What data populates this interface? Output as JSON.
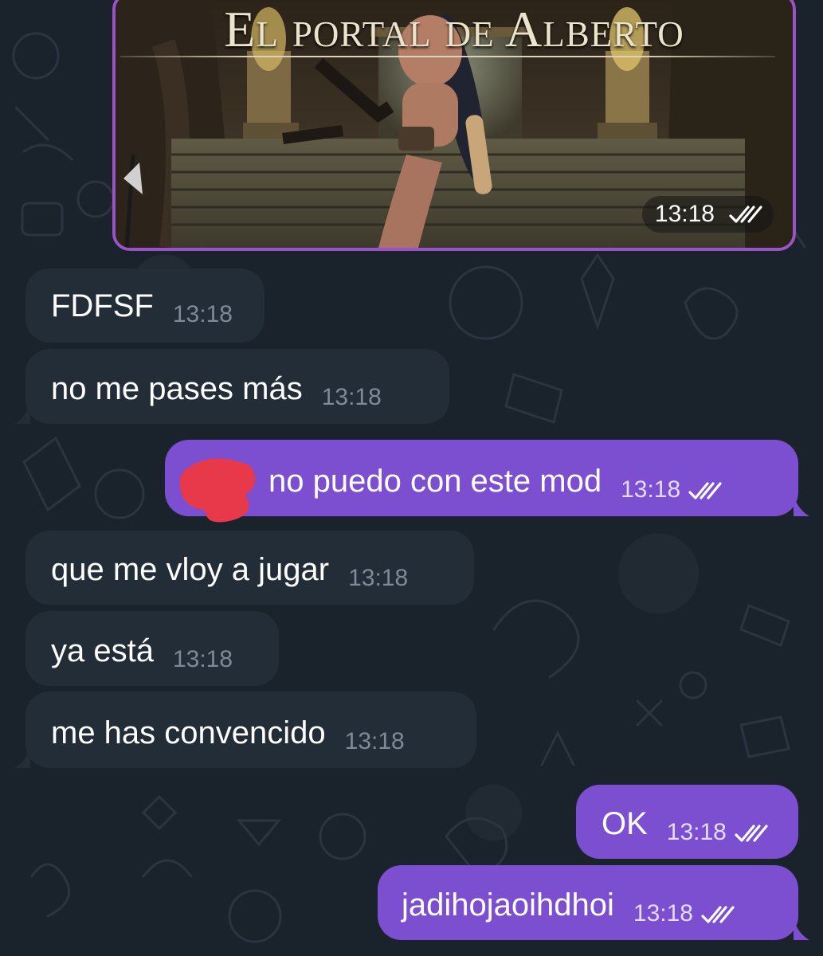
{
  "media": {
    "title": "El portal de Alberto",
    "time": "13:18"
  },
  "messages": [
    {
      "text": "FDFSF",
      "time": "13:18"
    },
    {
      "text": "no me pases más",
      "time": "13:18"
    },
    {
      "text": "no puedo con este mod",
      "time": "13:18"
    },
    {
      "text": "que me vloy a jugar",
      "time": "13:18"
    },
    {
      "text": "ya está",
      "time": "13:18"
    },
    {
      "text": "me has convencido",
      "time": "13:18"
    },
    {
      "text": "OK",
      "time": "13:18"
    },
    {
      "text": "jadihojaoihdhoi",
      "time": "13:18"
    }
  ],
  "colors": {
    "background": "#1a222c",
    "incoming_bubble": "#222d38",
    "outgoing_bubble": "#7b4fcf",
    "media_border": "#9a52c8",
    "redaction": "#e8394a"
  },
  "icons": {
    "read_receipt": "double-check-icon"
  }
}
